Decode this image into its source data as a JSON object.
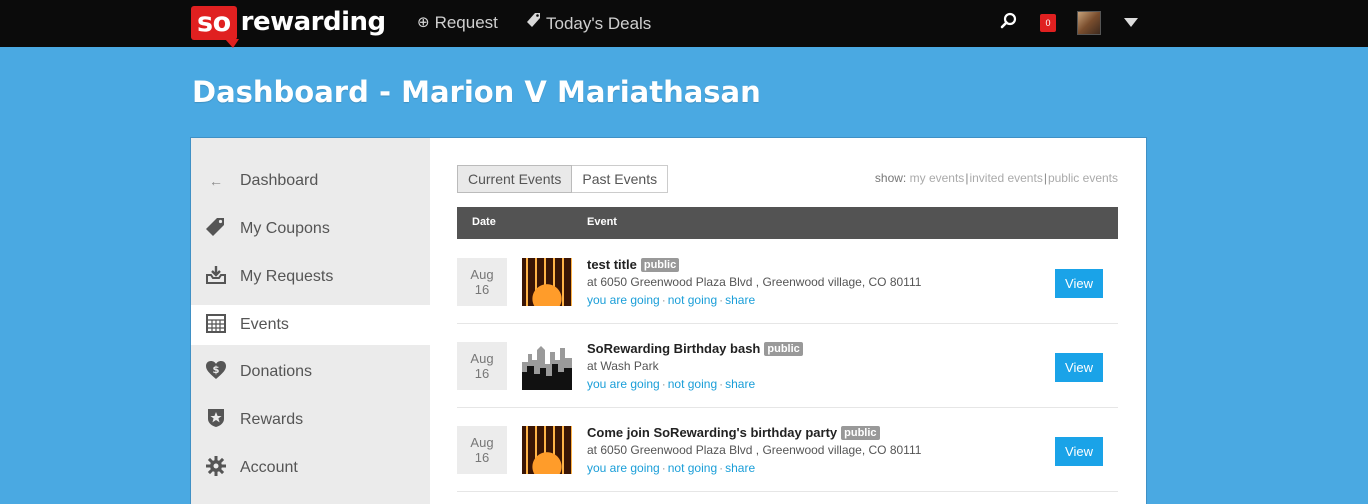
{
  "brand": {
    "so": "so",
    "rest": "rewarding"
  },
  "nav": {
    "request": "Request",
    "deals": "Today's Deals"
  },
  "notifications": {
    "count": "0"
  },
  "page_title": "Dashboard - Marion V Mariathasan",
  "sidebar": {
    "items": [
      {
        "label": "Dashboard",
        "icon": "back-arrow-icon",
        "active": false
      },
      {
        "label": "My Coupons",
        "icon": "tag-icon",
        "active": false
      },
      {
        "label": "My Requests",
        "icon": "inbox-download-icon",
        "active": false
      },
      {
        "label": "Events",
        "icon": "calendar-icon",
        "active": true
      },
      {
        "label": "Donations",
        "icon": "heart-dollar-icon",
        "active": false
      },
      {
        "label": "Rewards",
        "icon": "star-badge-icon",
        "active": false
      },
      {
        "label": "Account",
        "icon": "gear-icon",
        "active": false
      }
    ]
  },
  "tabs": {
    "current": "Current Events",
    "past": "Past Events"
  },
  "show_filter": {
    "label": "show:",
    "my": "my events",
    "invited": "invited events",
    "public": "public events"
  },
  "table": {
    "col_date": "Date",
    "col_event": "Event"
  },
  "events": [
    {
      "month": "Aug",
      "day": "16",
      "title": "test title",
      "badge": "public",
      "location": "at 6050 Greenwood Plaza Blvd , Greenwood village, CO 80111",
      "going": "you are going",
      "not_going": "not going",
      "share": "share",
      "view": "View",
      "thumb": "birthday-cake-image"
    },
    {
      "month": "Aug",
      "day": "16",
      "title": "SoRewarding Birthday bash",
      "badge": "public",
      "location": "at Wash Park",
      "going": "you are going",
      "not_going": "not going",
      "share": "share",
      "view": "View",
      "thumb": "city-skyline-image"
    },
    {
      "month": "Aug",
      "day": "16",
      "title": "Come join SoRewarding's birthday party",
      "badge": "public",
      "location": "at 6050 Greenwood Plaza Blvd , Greenwood village, CO 80111",
      "going": "you are going",
      "not_going": "not going",
      "share": "share",
      "view": "View",
      "thumb": "birthday-cake-image"
    }
  ],
  "colors": {
    "background": "#4aa9e2",
    "topbar": "#0b0b0b",
    "brand_red": "#e02020",
    "view_button": "#1aa3e8",
    "link": "#1a9ed8"
  }
}
